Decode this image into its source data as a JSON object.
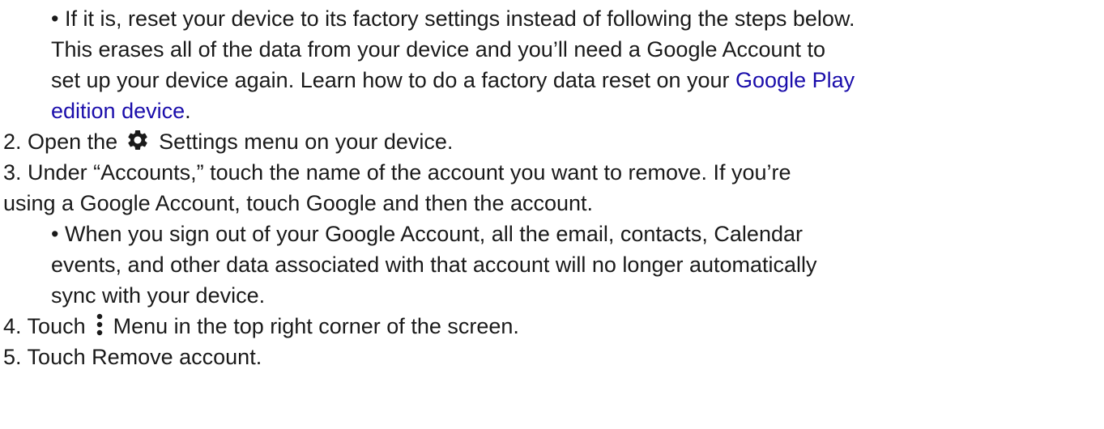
{
  "bullet": "•",
  "section1": {
    "line1": "If it is, reset your device to its factory settings instead of following the steps below.",
    "line2": "This erases all of the data from your device and you’ll need a Google Account to",
    "line3_pre": "set up your device again. Learn how to do a factory data reset on your ",
    "link_part1": "Google Play",
    "link_part2": "edition device",
    "line4_post": "."
  },
  "step2": {
    "number": "2.",
    "pre": "Open the",
    "icon": "gear-icon",
    "post": "Settings menu on your device."
  },
  "step3": {
    "number": "3.",
    "line1": "Under “Accounts,” touch the name of the account you want to remove. If you’re",
    "line2": "using a Google Account, touch Google and then the account.",
    "note_line1": "When you sign out of your Google Account, all the email, contacts, Calendar",
    "note_line2": "events, and other data associated with that account will no longer automatically",
    "note_line3": "sync with your device."
  },
  "step4": {
    "number": "4.",
    "pre": "Touch",
    "icon": "more-vert-icon",
    "post": "Menu in the top right corner of the screen."
  },
  "step5": {
    "number": "5.",
    "text": "Touch Remove account."
  }
}
